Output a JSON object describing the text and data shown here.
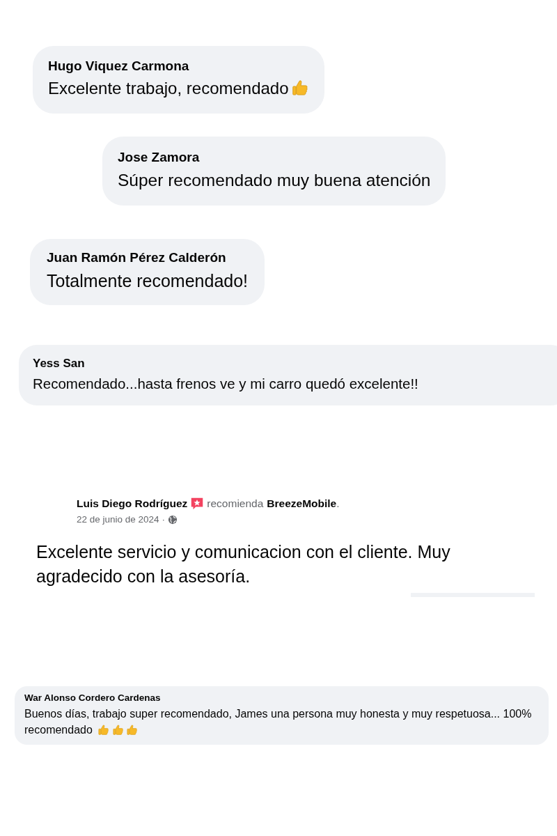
{
  "comments_top": [
    {
      "author": "Hugo Viquez Carmona",
      "text": "Excelente trabajo, recomendado",
      "reactions": [
        {
          "kind": "thumbs-up"
        }
      ]
    },
    {
      "author": "Jose Zamora",
      "text": "Súper recomendado muy buena atención"
    },
    {
      "author": "Juan Ramón Pérez Calderón",
      "text": "Totalmente recomendado!"
    },
    {
      "author": "Yess San",
      "text": "Recomendado...hasta frenos ve y mi carro quedó excelente!!"
    }
  ],
  "post": {
    "author": "Luis Diego Rodríguez",
    "verb": "recomienda",
    "page": "BreezeMobile",
    "period": ".",
    "date": "22 de junio de 2024",
    "separator": "·",
    "body": "Excelente servicio y comunicacion con el cliente. Muy agradecido con la asesoría."
  },
  "comments_bottom": [
    {
      "author": "War Alonso Cordero Cardenas",
      "text": "Buenos días, trabajo super recomendado, James una persona muy honesta y muy respetuosa... 100% recomendado",
      "reactions": [
        {
          "kind": "thumbs-up"
        },
        {
          "kind": "thumbs-up"
        },
        {
          "kind": "thumbs-up"
        }
      ]
    }
  ]
}
